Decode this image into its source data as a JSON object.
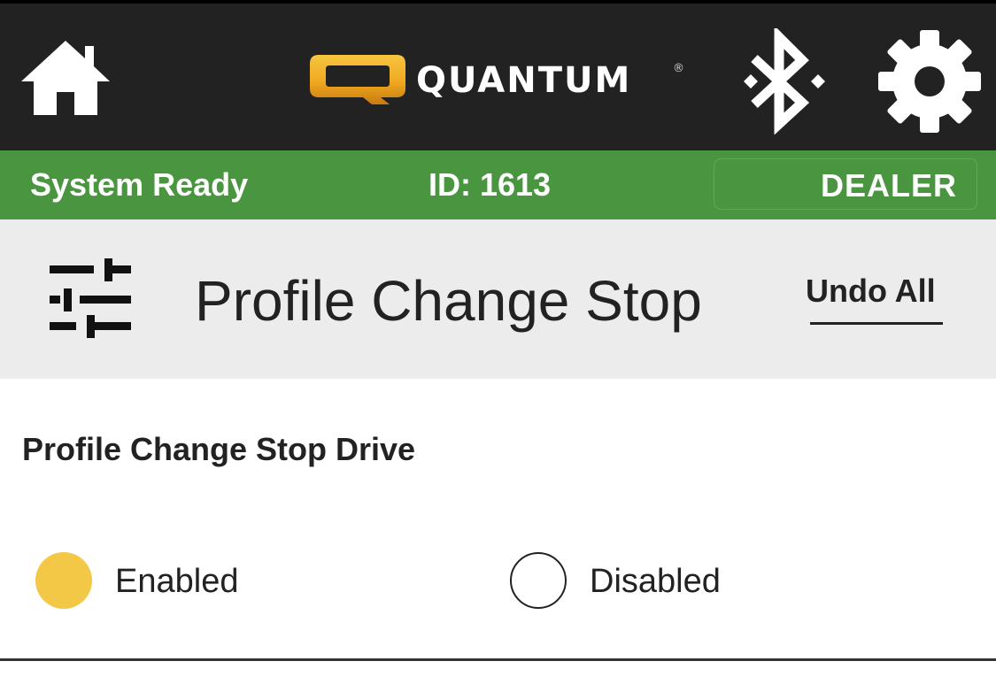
{
  "header": {
    "home_icon": "home-icon",
    "logo_text": "QUANTUM",
    "logo_registered": "®",
    "bluetooth_icon": "bluetooth-icon",
    "settings_icon": "gear-icon",
    "background_color": "#222222"
  },
  "status": {
    "text": "System Ready",
    "id_text": "ID: 1613",
    "dealer_label": "DEALER",
    "background_color": "#4a9640"
  },
  "title_band": {
    "icon": "sliders-icon",
    "title": "Profile Change Stop",
    "undo_label": "Undo All"
  },
  "setting": {
    "heading": "Profile Change Stop Drive",
    "options": [
      {
        "label": "Enabled",
        "selected": true
      },
      {
        "label": "Disabled",
        "selected": false
      }
    ],
    "selected_color": "#f3c847"
  }
}
